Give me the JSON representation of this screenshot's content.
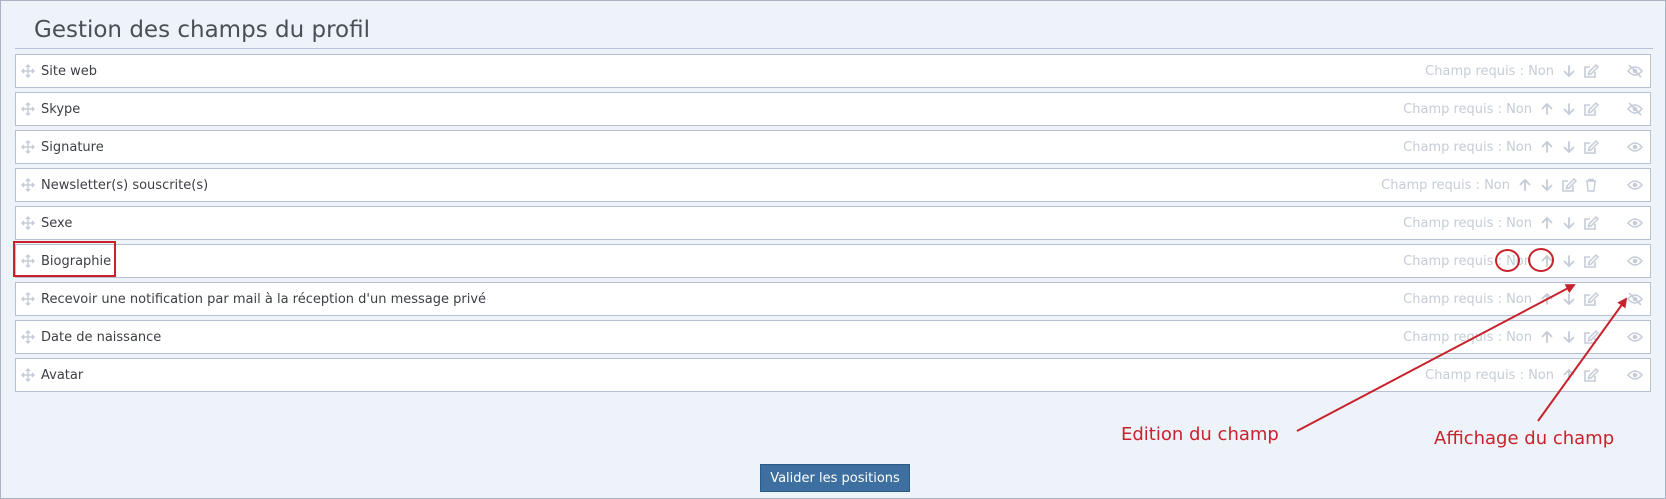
{
  "page": {
    "title": "Gestion des champs du profil",
    "validate_label": "Valider les positions"
  },
  "colors": {
    "panel_bg": "#eef2f9",
    "row_border": "#b6c2d4",
    "icon_muted": "#c5ccd7",
    "button_bg": "#3d6fa0",
    "annotation": "#c8232c"
  },
  "fields": [
    {
      "label": "Site web",
      "required_text": "Champ requis : Non",
      "icons": [
        "down-icon",
        "edit-icon",
        "eye-off-icon"
      ]
    },
    {
      "label": "Skype",
      "required_text": "Champ requis : Non",
      "icons": [
        "up-icon",
        "down-icon",
        "edit-icon",
        "eye-off-icon"
      ]
    },
    {
      "label": "Signature",
      "required_text": "Champ requis : Non",
      "icons": [
        "up-icon",
        "down-icon",
        "edit-icon",
        "eye-icon"
      ]
    },
    {
      "label": "Newsletter(s) souscrite(s)",
      "required_text": "Champ requis : Non",
      "icons": [
        "up-icon",
        "down-icon",
        "edit-icon",
        "trash-icon",
        "eye-icon"
      ]
    },
    {
      "label": "Sexe",
      "required_text": "Champ requis : Non",
      "icons": [
        "up-icon",
        "down-icon",
        "edit-icon",
        "eye-icon"
      ]
    },
    {
      "label": "Biographie",
      "required_text": "Champ requis : Non",
      "icons": [
        "up-icon",
        "down-icon",
        "edit-icon",
        "eye-icon"
      ]
    },
    {
      "label": "Recevoir une notification par mail à la réception d'un message privé",
      "required_text": "Champ requis : Non",
      "icons": [
        "up-icon",
        "down-icon",
        "edit-icon",
        "eye-off-icon"
      ]
    },
    {
      "label": "Date de naissance",
      "required_text": "Champ requis : Non",
      "icons": [
        "up-icon",
        "down-icon",
        "edit-icon",
        "eye-icon"
      ]
    },
    {
      "label": "Avatar",
      "required_text": "Champ requis : Non",
      "icons": [
        "up-icon",
        "edit-icon",
        "eye-icon"
      ]
    }
  ],
  "annotations": {
    "edit_label": "Edition du champ",
    "display_label": "Affichage du champ"
  }
}
